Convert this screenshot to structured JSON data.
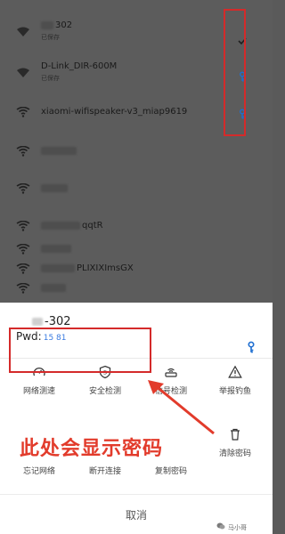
{
  "wifi_list": [
    {
      "name": "302",
      "status": "已保存",
      "icon": "wifi-lock-icon",
      "state_icon": "check-icon",
      "blurred_prefix": true
    },
    {
      "name": "D-Link_DIR-600M",
      "status": "已保存",
      "icon": "wifi-lock-icon",
      "state_icon": "key-icon",
      "blurred_prefix": false
    },
    {
      "name": "xiaomi-wifispeaker-v3_miap9619",
      "status": "",
      "icon": "wifi-icon",
      "state_icon": "key-icon",
      "blurred_prefix": false
    },
    {
      "name": "",
      "status": "",
      "icon": "wifi-icon",
      "blurred_prefix": true
    },
    {
      "name": "",
      "status": "",
      "icon": "wifi-icon",
      "blurred_prefix": true
    },
    {
      "name": "qqtR",
      "status": "",
      "icon": "wifi-icon",
      "blurred_prefix": true
    },
    {
      "name": "",
      "status": "",
      "icon": "wifi-icon",
      "blurred_prefix": true
    },
    {
      "name": "PLIXIXImsGX",
      "status": "",
      "icon": "wifi-icon",
      "blurred_prefix": true
    },
    {
      "name": "",
      "status": "",
      "icon": "wifi-icon",
      "blurred_prefix": true
    }
  ],
  "sheet": {
    "ssid": "-302",
    "pwd_label": "Pwd:",
    "pwd_value": "15       81",
    "key_icon": "key-icon"
  },
  "actions": [
    {
      "label": "网络测速",
      "icon": "speedometer-icon"
    },
    {
      "label": "安全检测",
      "icon": "shield-icon"
    },
    {
      "label": "信号检测",
      "icon": "router-icon"
    },
    {
      "label": "举报钓鱼",
      "icon": "warning-icon"
    },
    {
      "label": "忘记网络",
      "icon": "forget-icon"
    },
    {
      "label": "断开连接",
      "icon": "disconnect-icon"
    },
    {
      "label": "复制密码",
      "icon": "copy-icon"
    },
    {
      "label": "清除密码",
      "icon": "trash-icon"
    }
  ],
  "annotation": "此处会显示密码",
  "cancel_label": "取消",
  "watermark": "马小哥",
  "colors": {
    "highlight": "#d42a2a",
    "annotation": "#e23b2b",
    "key_blue": "#1f6fd1",
    "pwd_blue": "#3a7be0"
  }
}
